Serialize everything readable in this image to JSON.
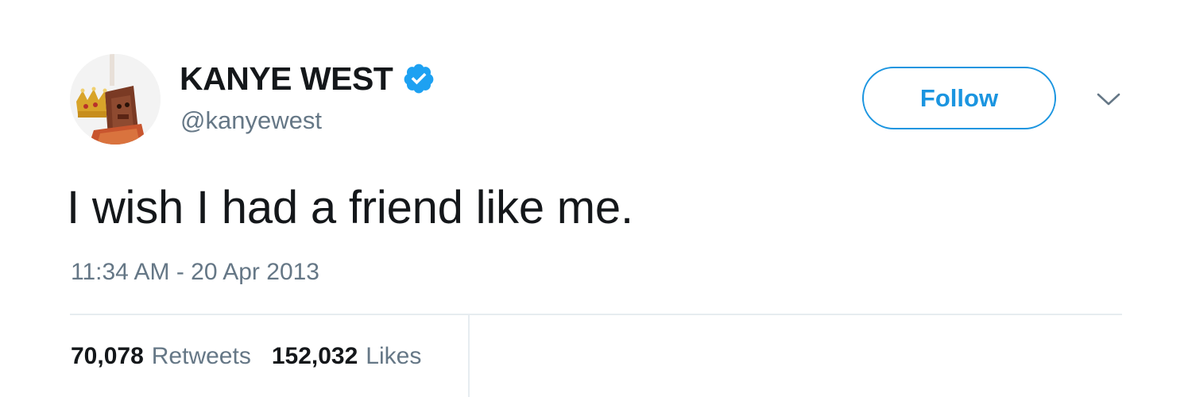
{
  "tweet": {
    "author": {
      "display_name": "KANYE WEST",
      "handle": "@kanyewest",
      "verified": true,
      "avatar_icon": "crowned-bear-avatar"
    },
    "follow_label": "Follow",
    "menu_icon": "chevron-down-icon",
    "text": "I wish I had a friend like me.",
    "timestamp": "11:34 AM - 20 Apr 2013",
    "stats": {
      "retweets_count": "70,078",
      "retweets_label": "Retweets",
      "likes_count": "152,032",
      "likes_label": "Likes"
    }
  },
  "colors": {
    "brand_blue": "#1b95e0",
    "verified_blue": "#1da1f2",
    "text_primary": "#14171a",
    "text_secondary": "#657786",
    "divider": "#e6ecf0"
  }
}
